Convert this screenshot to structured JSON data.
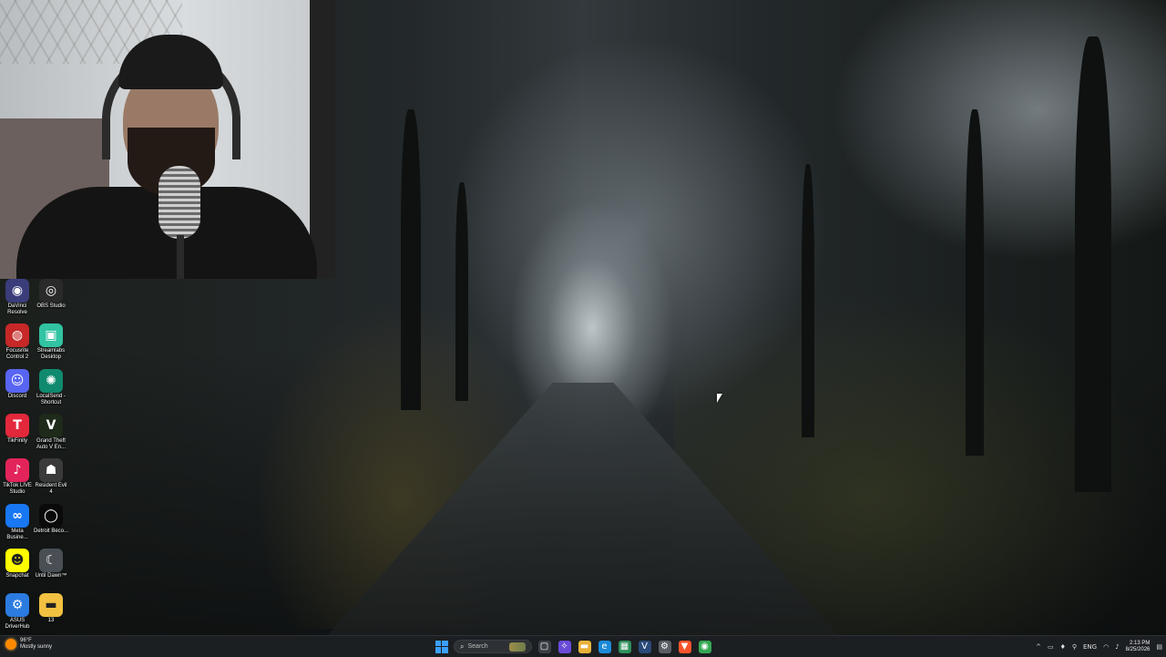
{
  "desktop_icons": [
    {
      "label": "DaVinci Resolve",
      "icon": "davinci-resolve-icon",
      "color": "#3a3d7a",
      "glyph": "◉"
    },
    {
      "label": "OBS Studio",
      "icon": "obs-studio-icon",
      "color": "#2a2a2a",
      "glyph": "◎"
    },
    {
      "label": "Focusrite Control 2",
      "icon": "focusrite-icon",
      "color": "#c62828",
      "glyph": "◍"
    },
    {
      "label": "Streamlabs Desktop",
      "icon": "streamlabs-icon",
      "color": "#31c3a2",
      "glyph": "▣"
    },
    {
      "label": "Discord",
      "icon": "discord-icon",
      "color": "#5865f2",
      "glyph": "☺"
    },
    {
      "label": "LocalSend - Shortcut",
      "icon": "localsend-icon",
      "color": "#0f8a6e",
      "glyph": "✺"
    },
    {
      "label": "TikFinity",
      "icon": "tikfinity-icon",
      "color": "#e3283c",
      "glyph": "T"
    },
    {
      "label": "Grand Theft Auto V En...",
      "icon": "gta-v-icon",
      "color": "#1e2a1a",
      "glyph": "V"
    },
    {
      "label": "TikTok LIVE Studio",
      "icon": "tiktok-live-icon",
      "color": "#e2245a",
      "glyph": "♪"
    },
    {
      "label": "Resident Evil 4",
      "icon": "resident-evil-icon",
      "color": "#3a3a3a",
      "glyph": "☗"
    },
    {
      "label": "Meta Busine...",
      "icon": "meta-business-icon",
      "color": "#1877f2",
      "glyph": "∞"
    },
    {
      "label": "Detroit Beco...",
      "icon": "detroit-icon",
      "color": "#0a0a0a",
      "glyph": "◯"
    },
    {
      "label": "Snapchat",
      "icon": "snapchat-icon",
      "color": "#fffc00",
      "glyph": "☻"
    },
    {
      "label": "Until Dawn™",
      "icon": "until-dawn-icon",
      "color": "#4a4f55",
      "glyph": "☾"
    },
    {
      "label": "ASUS DriverHub",
      "icon": "asus-driverhub-icon",
      "color": "#2b7be0",
      "glyph": "⚙"
    },
    {
      "label": "13",
      "icon": "folder-icon",
      "color": "#f2c141",
      "glyph": "▬"
    }
  ],
  "taskbar": {
    "weather_temp": "96°F",
    "weather_desc": "Mostly sunny",
    "search_placeholder": "Search",
    "pinned": [
      {
        "name": "task-view",
        "icon": "task-view-icon",
        "color": "#3b4046",
        "glyph": "▢"
      },
      {
        "name": "copilot",
        "icon": "copilot-icon",
        "color": "#6a4bd8",
        "glyph": "✧"
      },
      {
        "name": "file-explorer",
        "icon": "file-explorer-icon",
        "color": "#e8b23a",
        "glyph": "▬"
      },
      {
        "name": "edge",
        "icon": "edge-icon",
        "color": "#1b8ad9",
        "glyph": "e"
      },
      {
        "name": "microsoft-store",
        "icon": "store-icon",
        "color": "#2d8f5a",
        "glyph": "▦"
      },
      {
        "name": "vectorize",
        "icon": "v-app-icon",
        "color": "#2a4a7a",
        "glyph": "V"
      },
      {
        "name": "settings",
        "icon": "settings-icon",
        "color": "#5a5f66",
        "glyph": "⚙"
      },
      {
        "name": "brave",
        "icon": "brave-icon",
        "color": "#fb542b",
        "glyph": "▼"
      },
      {
        "name": "chrome",
        "icon": "chrome-icon",
        "color": "#34a853",
        "glyph": "◉"
      }
    ],
    "tray": {
      "chevron": "^",
      "language": "ENG",
      "time": "2:13 PM",
      "date": "8/25/2026"
    }
  }
}
